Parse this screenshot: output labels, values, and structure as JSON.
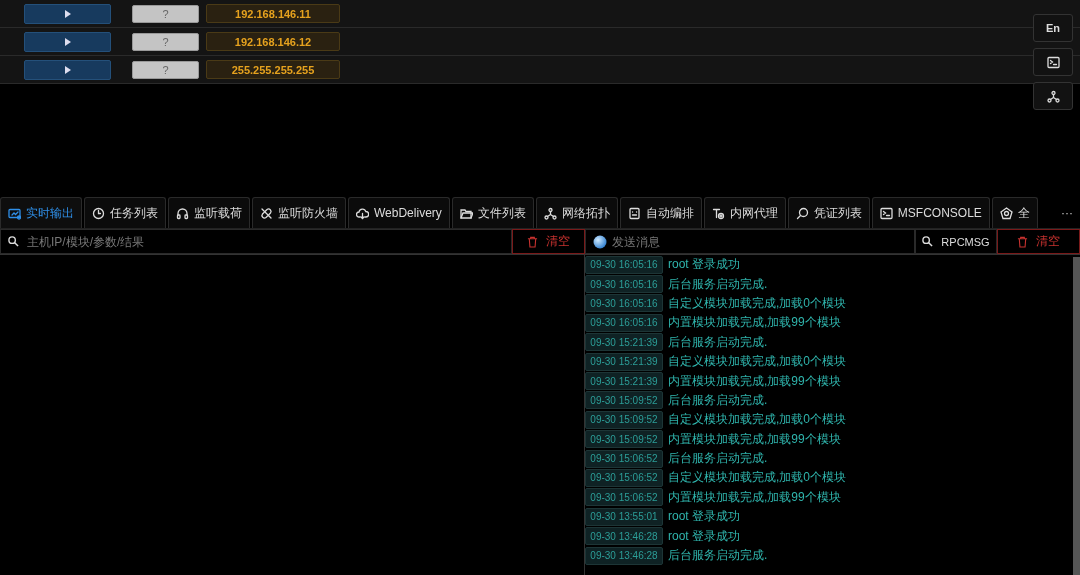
{
  "hosts": [
    {
      "ip": "192.168.146.11",
      "status": "?"
    },
    {
      "ip": "192.168.146.12",
      "status": "?"
    },
    {
      "ip": "255.255.255.255",
      "status": "?"
    }
  ],
  "side_buttons": [
    {
      "kind": "text",
      "label": "En"
    },
    {
      "kind": "terminal"
    },
    {
      "kind": "network"
    }
  ],
  "tabs": [
    {
      "label": "实时输出",
      "selected": true
    },
    {
      "label": "任务列表",
      "selected": false
    },
    {
      "label": "监听载荷",
      "selected": false
    },
    {
      "label": "监听防火墙",
      "selected": false
    },
    {
      "label": "WebDelivery",
      "selected": false
    },
    {
      "label": "文件列表",
      "selected": false
    },
    {
      "label": "网络拓扑",
      "selected": false
    },
    {
      "label": "自动编排",
      "selected": false
    },
    {
      "label": "内网代理",
      "selected": false
    },
    {
      "label": "凭证列表",
      "selected": false
    },
    {
      "label": "MSFCONSOLE",
      "selected": false
    },
    {
      "label": "全",
      "selected": false
    }
  ],
  "tabs_more": "···",
  "output_search": {
    "placeholder": "主机IP/模块/参数/结果"
  },
  "output_clear": "清空",
  "message_input": {
    "placeholder": "发送消息"
  },
  "rpcmsg_button": "RPCMSG",
  "message_clear": "清空",
  "log": [
    {
      "time": "09-30 16:05:16",
      "text": "root 登录成功"
    },
    {
      "time": "09-30 16:05:16",
      "text": "后台服务启动完成."
    },
    {
      "time": "09-30 16:05:16",
      "text": "自定义模块加载完成,加载0个模块"
    },
    {
      "time": "09-30 16:05:16",
      "text": "内置模块加载完成,加载99个模块"
    },
    {
      "time": "09-30 15:21:39",
      "text": "后台服务启动完成."
    },
    {
      "time": "09-30 15:21:39",
      "text": "自定义模块加载完成,加载0个模块"
    },
    {
      "time": "09-30 15:21:39",
      "text": "内置模块加载完成,加载99个模块"
    },
    {
      "time": "09-30 15:09:52",
      "text": "后台服务启动完成."
    },
    {
      "time": "09-30 15:09:52",
      "text": "自定义模块加载完成,加载0个模块"
    },
    {
      "time": "09-30 15:09:52",
      "text": "内置模块加载完成,加载99个模块"
    },
    {
      "time": "09-30 15:06:52",
      "text": "后台服务启动完成."
    },
    {
      "time": "09-30 15:06:52",
      "text": "自定义模块加载完成,加载0个模块"
    },
    {
      "time": "09-30 15:06:52",
      "text": "内置模块加载完成,加载99个模块"
    },
    {
      "time": "09-30 13:55:01",
      "text": "root 登录成功"
    },
    {
      "time": "09-30 13:46:28",
      "text": "root 登录成功"
    },
    {
      "time": "09-30 13:46:28",
      "text": "后台服务启动完成."
    }
  ]
}
